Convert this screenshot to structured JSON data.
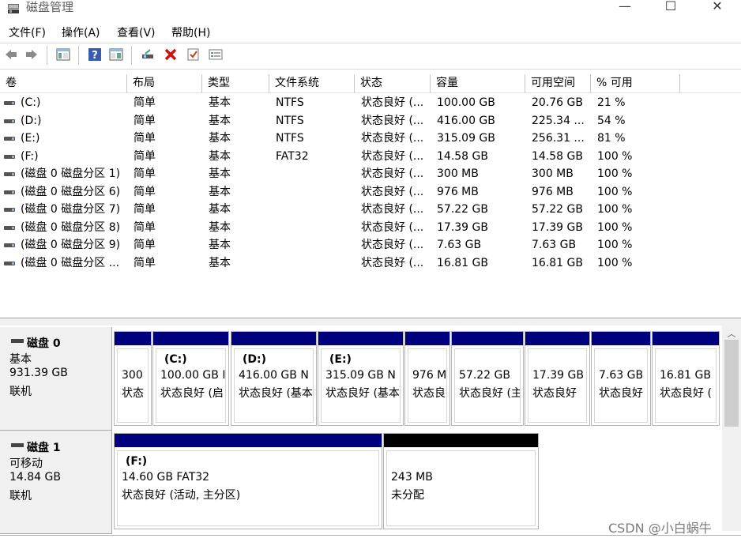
{
  "window": {
    "title": "磁盘管理",
    "minimize": "—",
    "maximize": "☐",
    "close": "✕"
  },
  "menu": [
    "文件(F)",
    "操作(A)",
    "查看(V)",
    "帮助(H)"
  ],
  "toolbar_icons": [
    "back-icon",
    "forward-icon",
    "console-tree-icon",
    "help-icon",
    "show-pane-icon",
    "connect-icon",
    "delete-icon",
    "check-icon",
    "properties-icon"
  ],
  "columns": [
    "卷",
    "布局",
    "类型",
    "文件系统",
    "状态",
    "容量",
    "可用空间",
    "% 可用"
  ],
  "volumes": [
    {
      "vol": "(C:)",
      "layout": "简单",
      "type": "基本",
      "fs": "NTFS",
      "status": "状态良好 (...",
      "cap": "100.00 GB",
      "free": "20.76 GB",
      "pct": "21 %"
    },
    {
      "vol": "(D:)",
      "layout": "简单",
      "type": "基本",
      "fs": "NTFS",
      "status": "状态良好 (...",
      "cap": "416.00 GB",
      "free": "225.34 ...",
      "pct": "54 %"
    },
    {
      "vol": "(E:)",
      "layout": "简单",
      "type": "基本",
      "fs": "NTFS",
      "status": "状态良好 (...",
      "cap": "315.09 GB",
      "free": "256.31 ...",
      "pct": "81 %"
    },
    {
      "vol": "(F:)",
      "layout": "简单",
      "type": "基本",
      "fs": "FAT32",
      "status": "状态良好 (...",
      "cap": "14.58 GB",
      "free": "14.58 GB",
      "pct": "100 %"
    },
    {
      "vol": "(磁盘 0 磁盘分区 1)",
      "layout": "简单",
      "type": "基本",
      "fs": "",
      "status": "状态良好 (...",
      "cap": "300 MB",
      "free": "300 MB",
      "pct": "100 %"
    },
    {
      "vol": "(磁盘 0 磁盘分区 6)",
      "layout": "简单",
      "type": "基本",
      "fs": "",
      "status": "状态良好 (...",
      "cap": "976 MB",
      "free": "976 MB",
      "pct": "100 %"
    },
    {
      "vol": "(磁盘 0 磁盘分区 7)",
      "layout": "简单",
      "type": "基本",
      "fs": "",
      "status": "状态良好 (...",
      "cap": "57.22 GB",
      "free": "57.22 GB",
      "pct": "100 %"
    },
    {
      "vol": "(磁盘 0 磁盘分区 8)",
      "layout": "简单",
      "type": "基本",
      "fs": "",
      "status": "状态良好 (...",
      "cap": "17.39 GB",
      "free": "17.39 GB",
      "pct": "100 %"
    },
    {
      "vol": "(磁盘 0 磁盘分区 9)",
      "layout": "简单",
      "type": "基本",
      "fs": "",
      "status": "状态良好 (...",
      "cap": "7.63 GB",
      "free": "7.63 GB",
      "pct": "100 %"
    },
    {
      "vol": "(磁盘 0 磁盘分区 ...",
      "layout": "简单",
      "type": "基本",
      "fs": "",
      "status": "状态良好 (...",
      "cap": "16.81 GB",
      "free": "16.81 GB",
      "pct": "100 %"
    }
  ],
  "disk0": {
    "name": "磁盘 0",
    "type": "基本",
    "size": "931.39 GB",
    "state": "联机",
    "partitions": [
      {
        "label": "",
        "size": "300",
        "status": "状态"
      },
      {
        "label": "(C:)",
        "size": "100.00 GB I",
        "status": "状态良好 (启"
      },
      {
        "label": "(D:)",
        "size": "416.00 GB N",
        "status": "状态良好 (基本"
      },
      {
        "label": "(E:)",
        "size": "315.09 GB N",
        "status": "状态良好 (基本"
      },
      {
        "label": "",
        "size": "976 M",
        "status": "状态良"
      },
      {
        "label": "",
        "size": "57.22 GB",
        "status": "状态良好 (主"
      },
      {
        "label": "",
        "size": "17.39 GB",
        "status": "状态良好"
      },
      {
        "label": "",
        "size": "7.63 GB",
        "status": "状态良好"
      },
      {
        "label": "",
        "size": "16.81 GB",
        "status": "状态良好 ("
      }
    ]
  },
  "disk1": {
    "name": "磁盘 1",
    "type": "可移动",
    "size": "14.84 GB",
    "state": "联机",
    "partitions": [
      {
        "label": "(F:)",
        "size": "14.60 GB FAT32",
        "status": "状态良好 (活动, 主分区)"
      },
      {
        "label": "",
        "size": "243 MB",
        "status": "未分配"
      }
    ]
  },
  "colors": {
    "primary_partition": "#00007f",
    "unallocated": "#000000"
  },
  "watermark": "CSDN @小白蜗牛"
}
